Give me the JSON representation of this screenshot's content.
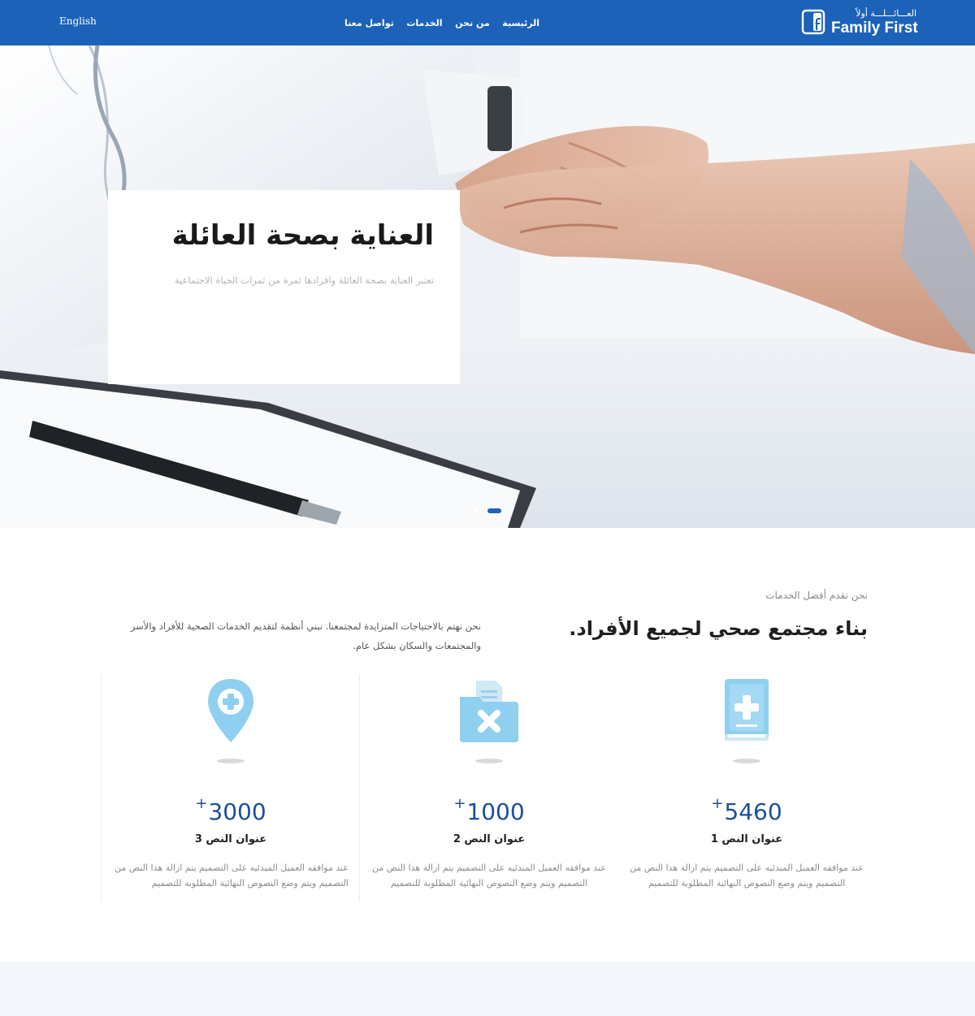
{
  "header": {
    "language_link": "English",
    "nav": [
      "الرئيسية",
      "من نحن",
      "الخدمات",
      "تواصل معنا"
    ],
    "logo": {
      "arabic": "العـــائـــلـــة أولاً",
      "english": "Family First"
    }
  },
  "hero": {
    "title": "العناية بصحة العائلة",
    "subtitle": "تعتبر العناية بصحة العائلة وافرادها ثمرة من ثمرات الحياة الاجتماعية",
    "slides_count": 2,
    "active_slide": 2
  },
  "intro": {
    "eyebrow": "نحن نقدم أفضل الخدمات",
    "title": "بناء مجتمع صحي لجميع الأفراد.",
    "text": "نحن نهتم بالاحتياجات المتزايدة لمجتمعنا. نبني أنظمة لتقديم الخدمات الصحية للأفراد والأسر والمجتمعات والسكان بشكل عام."
  },
  "stats": [
    {
      "icon": "medical-book-icon",
      "number": "5460",
      "plus": "+",
      "label": "عنوان النص 1",
      "text": "عند موافقه العميل المبدئيه على التصميم يتم ازالة هذا النص من التصميم ويتم وضع النصوص النهائية المطلوبة للتصميم"
    },
    {
      "icon": "medical-folder-icon",
      "number": "1000",
      "plus": "+",
      "label": "عنوان النص 2",
      "text": "عند موافقه العميل المبدئيه على التصميم يتم ازالة هذا النص من التصميم ويتم وضع النصوص النهائية المطلوبة للتصميم"
    },
    {
      "icon": "medical-location-pin-icon",
      "number": "3000",
      "plus": "+",
      "label": "عنوان النص 3",
      "text": "عند موافقه العميل المبدئيه على التصميم يتم ازالة هذا النص من التصميم ويتم وضع النصوص النهائية المطلوبة للتصميم"
    }
  ],
  "colors": {
    "brand_blue": "#1c62b9",
    "stat_number": "#1b4f9c",
    "icon_light_blue": "#8fd0f0"
  }
}
